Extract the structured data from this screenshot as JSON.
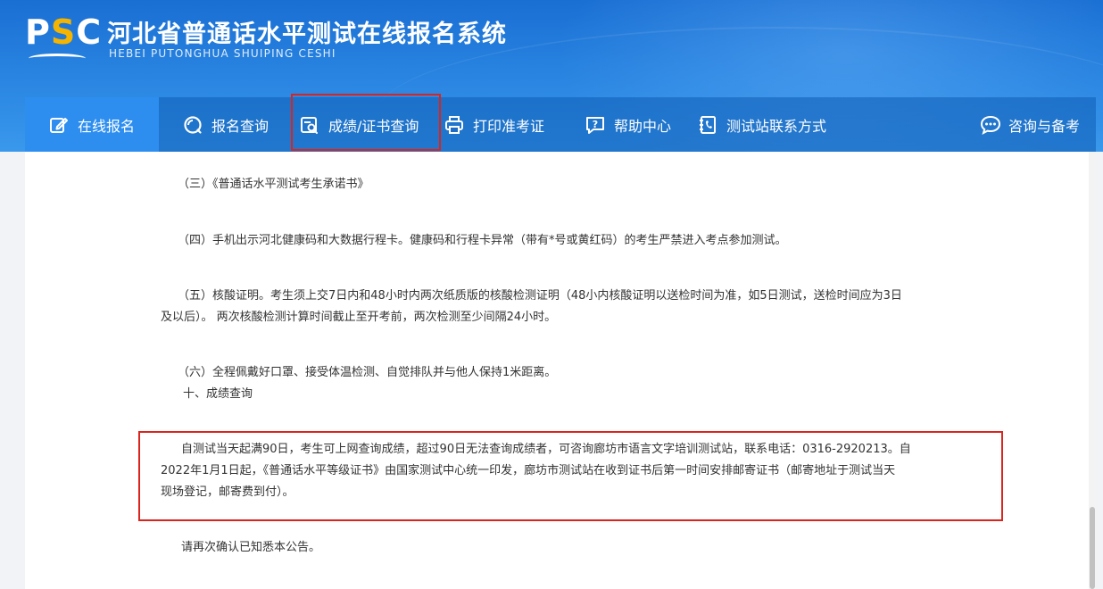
{
  "header": {
    "logo_prefix": "P",
    "logo_accent": "S",
    "logo_suffix": "C",
    "title": "河北省普通话水平测试在线报名系统",
    "subtitle": "HEBEI PUTONGHUA SHUIPING CESHI"
  },
  "nav": {
    "items": [
      {
        "label": "在线报名",
        "icon": "edit-icon"
      },
      {
        "label": "报名查询",
        "icon": "search-circle-icon"
      },
      {
        "label": "成绩/证书查询",
        "icon": "certificate-search-icon"
      },
      {
        "label": "打印准考证",
        "icon": "printer-icon"
      },
      {
        "label": "帮助中心",
        "icon": "help-chat-icon"
      },
      {
        "label": "测试站联系方式",
        "icon": "phone-book-icon"
      },
      {
        "label": "咨询与备考",
        "icon": "chat-bubble-icon"
      }
    ]
  },
  "content": {
    "item_3": "（三）《普通话水平测试考生承诺书》",
    "item_4": "（四）手机出示河北健康码和大数据行程卡。健康码和行程卡异常（带有*号或黄红码）的考生严禁进入考点参加测试。",
    "item_5_line1": "（五）核酸证明。考生须上交7日内和48小时内两次纸质版的核酸检测证明（48小内核酸证明以送检时间为准，如5日测试，送检时间应为3日",
    "item_5_line2": "及以后）。 两次核酸检测计算时间截止至开考前，两次检测至少间隔24小时。",
    "item_6": "（六）全程佩戴好口罩、接受体温检测、自觉排队并与他人保持1米距离。",
    "section_10": "十、成绩查询",
    "notice_line1": "自测试当天起满90日，考生可上网查询成绩，超过90日无法查询成绩者，可咨询廊坊市语言文字培训测试站，联系电话：0316-2920213。自",
    "notice_line2": "2022年1月1日起，《普通话水平等级证书》由国家测试中心统一印发，廊坊市测试站在收到证书后第一时间安排邮寄证书（邮寄地址于测试当天",
    "notice_line3": "现场登记，邮寄费到付）。",
    "closing": "请再次确认已知悉本公告。"
  },
  "colors": {
    "header_blue": "#2a86e2",
    "nav_active": "#2d8ef0",
    "highlight_red": "#d9251d",
    "logo_accent": "#f4b400"
  }
}
